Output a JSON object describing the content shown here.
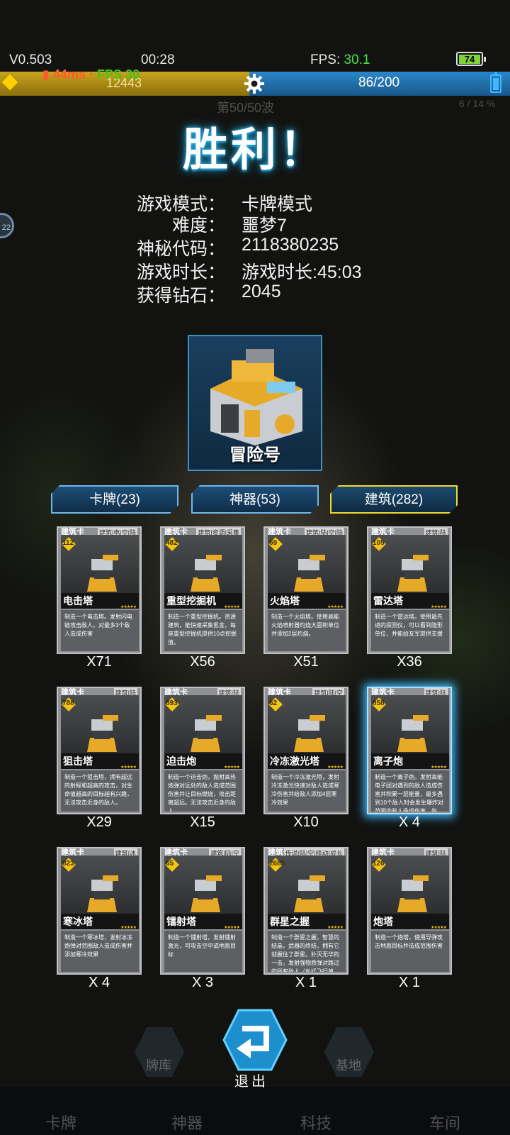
{
  "status": {
    "version": "V0.503",
    "time": "00:28",
    "fps_label": "FPS:",
    "fps_value": "30.1",
    "battery": "74"
  },
  "hud": {
    "gold": "12443",
    "ping": "44ms",
    "fps_overlay": "FPS 30",
    "population": "86/200",
    "wave": "第50/50波",
    "right_info": "6 / 14 %"
  },
  "title": "胜利！",
  "info": [
    {
      "label": "游戏模式：",
      "value": "卡牌模式"
    },
    {
      "label": "难度：",
      "value": "噩梦7"
    },
    {
      "label": "神秘代码：",
      "value": "2118380235"
    },
    {
      "label": "游戏时长：",
      "value": "游戏时长:45:03"
    },
    {
      "label": "获得钻石：",
      "value": "2045"
    }
  ],
  "building": {
    "name": "冒险号"
  },
  "tabs": [
    {
      "label": "卡牌(23)",
      "active": false
    },
    {
      "label": "神器(53)",
      "active": false
    },
    {
      "label": "建筑(282)",
      "active": true
    }
  ],
  "card_type": "建筑卡",
  "cards": [
    {
      "name": "电击塔",
      "cost": "112",
      "count": "X71",
      "tags": "建筑|电|空|陆",
      "desc": "制造一个电击塔。发射闪电链攻击敌人，对最多3个敌人造成伤害"
    },
    {
      "name": "重型挖掘机",
      "cost": "482",
      "count": "X56",
      "tags": "建筑|资源|采集",
      "desc": "制造一个重型挖掘机。资源建筑，能快速采集氪金，每座重型挖掘机提供10点挖掘值。"
    },
    {
      "name": "火焰塔",
      "cost": "69",
      "count": "X51",
      "tags": "建筑|陆|空|陆",
      "desc": "制造一个火焰塔。使用高能火焰喷射器灼烧大面积单位并添加2层灼烧。"
    },
    {
      "name": "雷达塔",
      "cost": "105",
      "count": "X36",
      "tags": "建筑|陆",
      "desc": "制造一个雷达塔。使用最先进的探测仪，可以看到隐形单位，并能给友军提供支援"
    },
    {
      "name": "狙击塔",
      "cost": "788",
      "count": "X29",
      "tags": "建筑|陆",
      "desc": "制造一个狙击塔，拥有超远的射程和超高的攻击，对生命值越高的目标越有兴趣，无法攻击近身的敌人。"
    },
    {
      "name": "迫击炮",
      "cost": "893",
      "count": "X15",
      "tags": "建筑|陆",
      "desc": "制造一个迫击炮，抛射高热炮弹对远处的敌人造成范围伤害并让目标燃烧，攻击距离超远。无法攻击近身的敌人"
    },
    {
      "name": "冷冻激光塔",
      "cost": "62",
      "count": "X10",
      "tags": "建筑|陆|空",
      "desc": "制造一个冷冻激光塔，发射冷冻激光快速对敌人造成寒冷伤害并给敌人添加4层寒冷效果"
    },
    {
      "name": "离子炮",
      "cost": "858",
      "count": "X 4",
      "tags": "建筑|陆",
      "desc": "制造一个离子炮。发射高能电子团对遇到的敌人造成伤害并积累一层能量，最多遇到10个敌人时会发生爆炸对范围内敌人造成伤害，每…"
    },
    {
      "name": "寒冰塔",
      "cost": "823",
      "count": "X 4",
      "tags": "建筑|冰",
      "desc": "制造一个寒冰塔，发射冰冻炮弹对范围敌人造成伤害并添加寒冷效果"
    },
    {
      "name": "镭射塔",
      "cost": "65",
      "count": "X 3",
      "tags": "建筑|陆|空",
      "desc": "制造一个镭射塔，发射镭射激光，可攻击空中或地面目标"
    },
    {
      "name": "群星之握",
      "cost": "2685",
      "count": "X 1",
      "tags": "传说|陆|空|移动|成长",
      "desc": "制造一个群星之握，智慧的结晶，武器的终结，拥有它就握住了群星。扑灭无华的一击，发射强物质弹对路过的所有敌人（包括飞行单…"
    },
    {
      "name": "炮塔",
      "cost": "126",
      "count": "X 1",
      "tags": "建筑|陆",
      "desc": "制造一个炮塔，使用导弹攻击地面目标并造成范围伤害"
    }
  ],
  "exit_label": "退出",
  "bottom_nav": [
    "卡牌",
    "神器",
    "科技",
    "车间"
  ],
  "mid_nav": [
    "牌库",
    "基地"
  ]
}
